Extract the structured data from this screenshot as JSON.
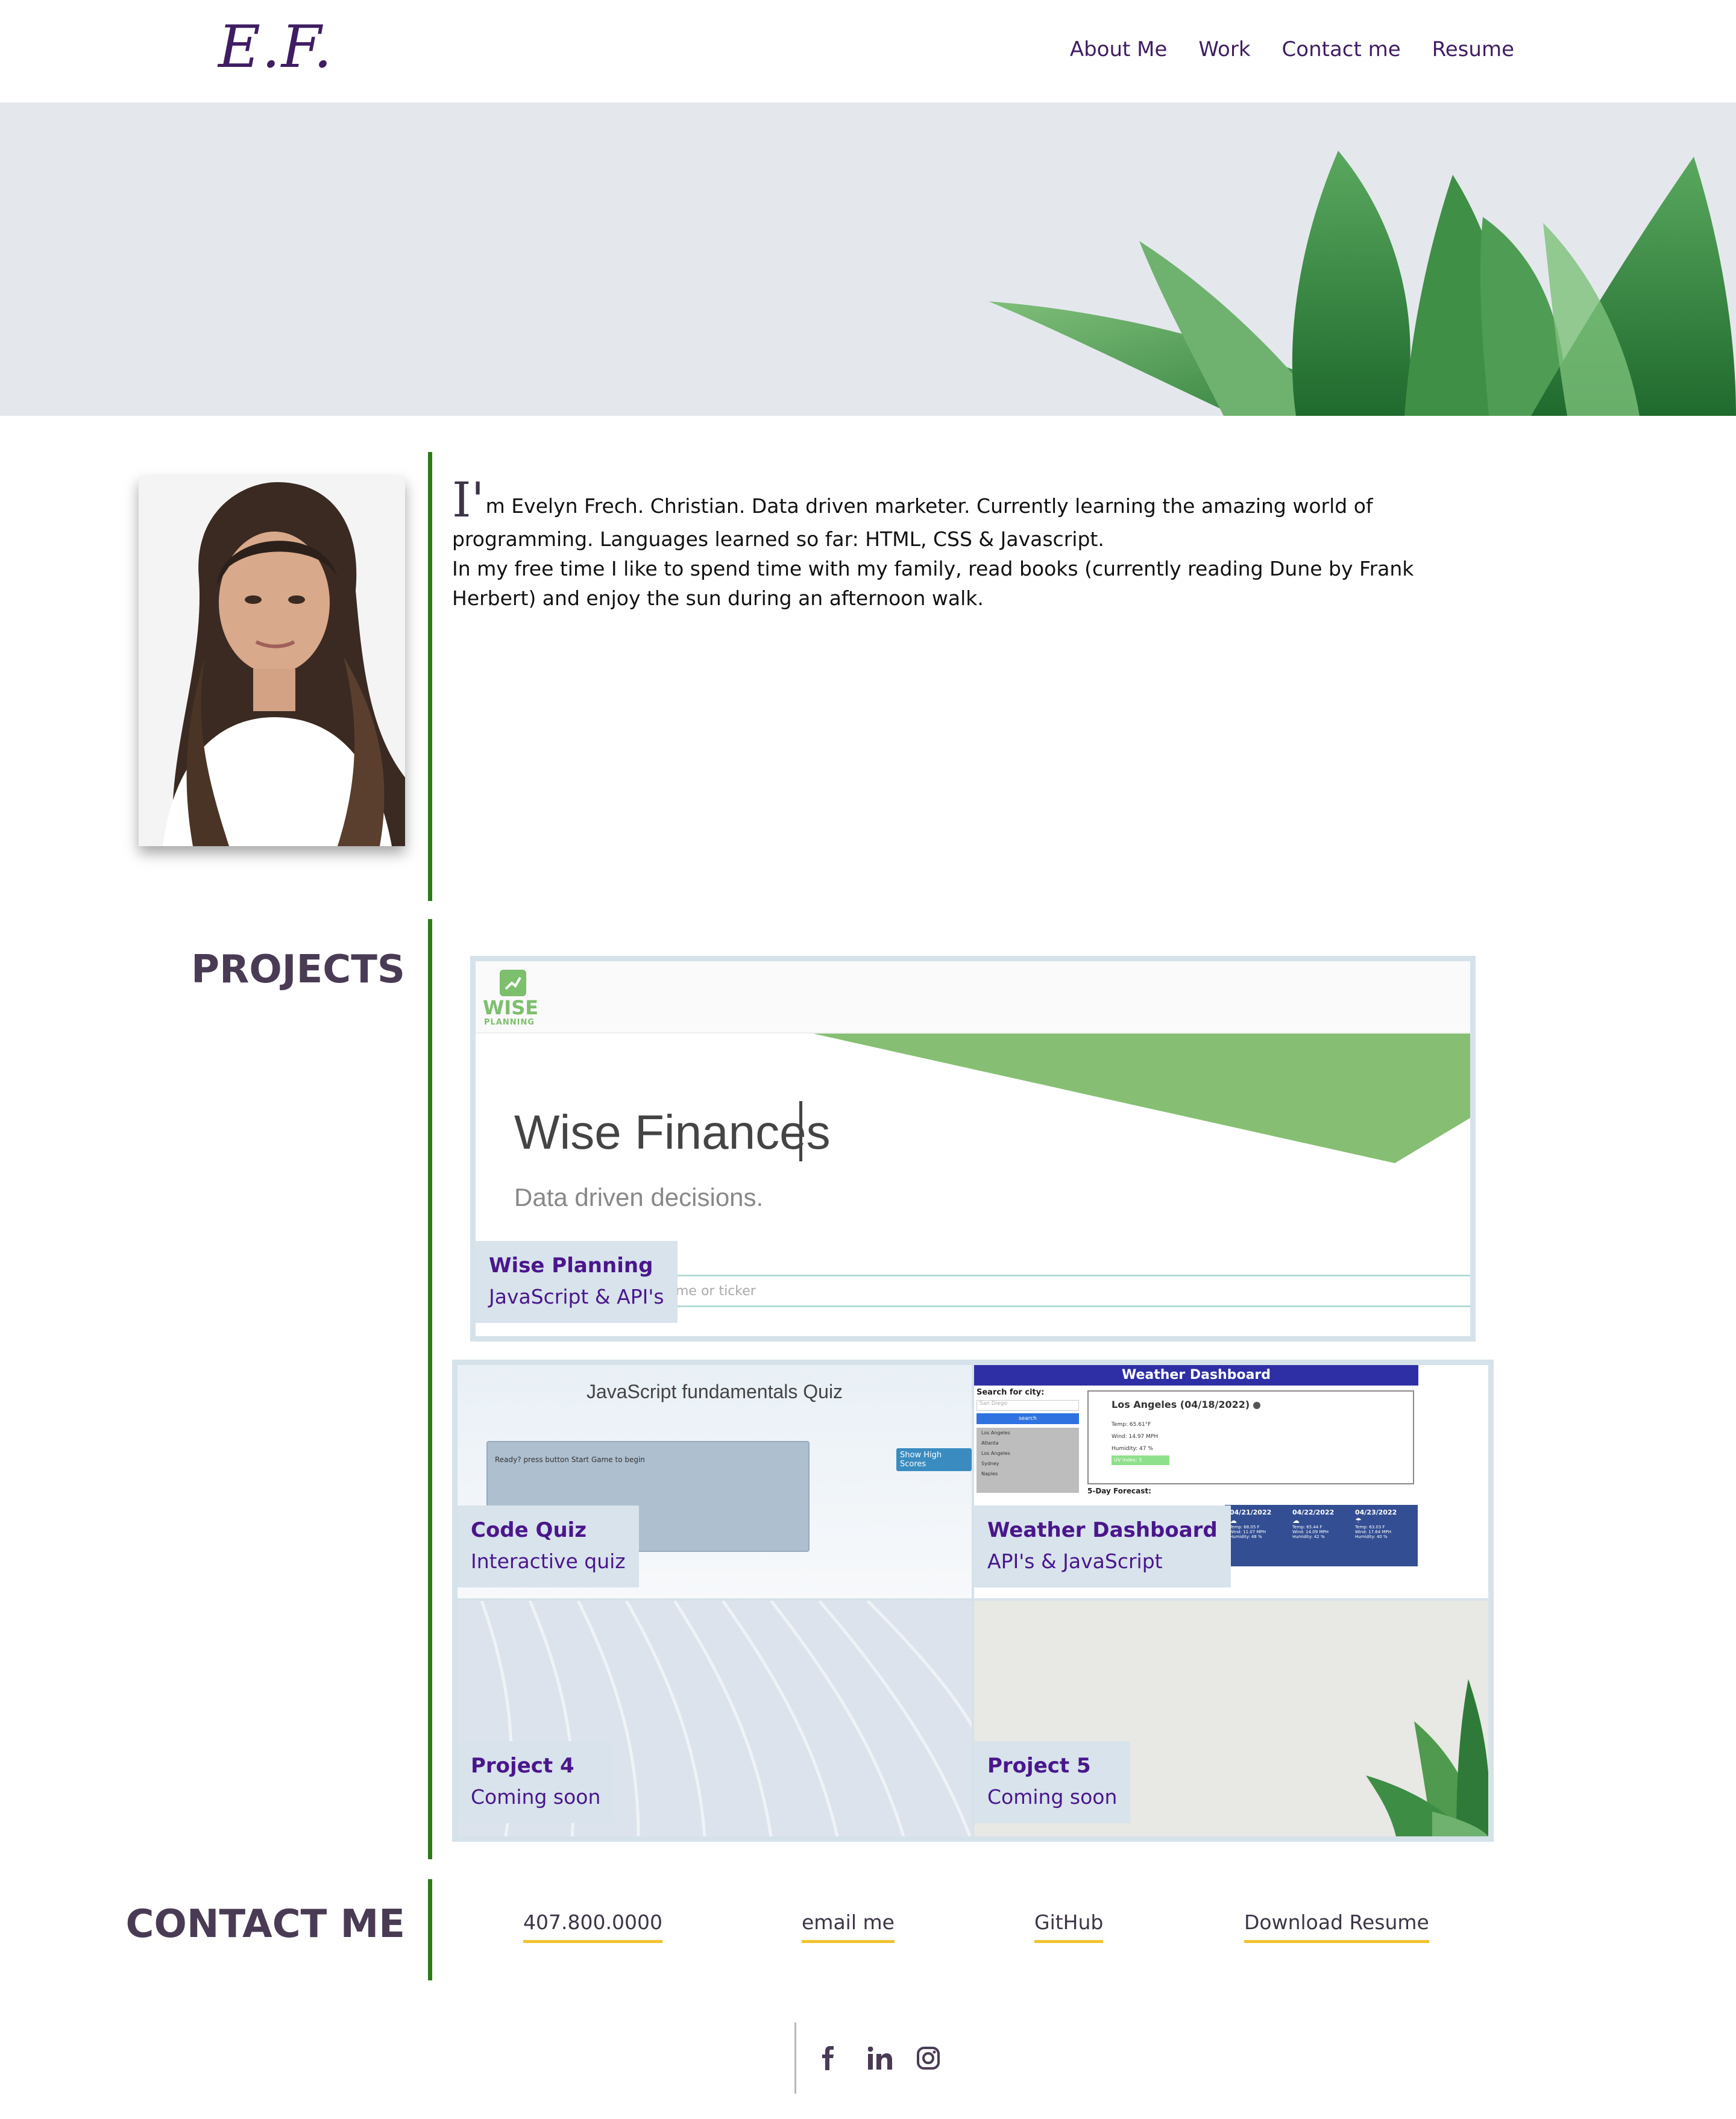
{
  "header": {
    "logo": "E.F.",
    "nav": [
      {
        "label": "About Me"
      },
      {
        "label": "Work"
      },
      {
        "label": "Contact me"
      },
      {
        "label": "Resume"
      }
    ]
  },
  "about": {
    "drop_letter": "I'",
    "line1": "m Evelyn Frech. Christian. Data driven marketer. Currently learning the amazing world of programming. Languages learned so far: HTML, CSS & Javascript.",
    "line2": "In my free time I like to spend time with my family, read books (currently reading Dune by Frank Herbert) and enjoy the sun during an afternoon walk."
  },
  "projects": {
    "title": "PROJECTS",
    "items": [
      {
        "title": "Wise Planning",
        "subtitle": "JavaScript & API's",
        "preview": {
          "brand": "WISE",
          "brand_sub": "PLANNING",
          "heading": "Wise Finances",
          "tagline": "Data driven decisions.",
          "search_placeholder": "me or ticker"
        }
      },
      {
        "title": "Code Quiz",
        "subtitle": "Interactive quiz",
        "preview": {
          "heading": "JavaScript fundamentals Quiz",
          "prompt": "Ready? press button Start Game to begin",
          "button": "Show High Scores"
        }
      },
      {
        "title": "Weather Dashboard",
        "subtitle": "API's & JavaScript",
        "preview": {
          "heading": "Weather Dashboard",
          "search_label": "Search for city:",
          "city_placeholder": "San Diego",
          "search_button": "search",
          "cities": [
            "Los Angeles",
            "Atlanta",
            "Los Angeles",
            "Sydney",
            "Naples"
          ],
          "current": "Los Angeles (04/18/2022)",
          "current_stats": [
            "Temp: 65.61°F",
            "Wind: 14.97 MPH",
            "Humidity: 47 %"
          ],
          "uv": "UV Index: 3",
          "forecast_label": "5-Day Forecast:",
          "forecast": [
            {
              "date": "04/21/2022",
              "stats": [
                "Temp: 68.05 F",
                "Wind: 11.07 MPH",
                "Humidity: 48 %"
              ]
            },
            {
              "date": "04/22/2022",
              "stats": [
                "Temp: 65.44 F",
                "Wind: 14.09 MPH",
                "Humidity: 42 %"
              ]
            },
            {
              "date": "04/23/2022",
              "stats": [
                "Temp: 63.03 F",
                "Wind: 17.64 MPH",
                "Humidity: 40 %"
              ]
            }
          ]
        }
      },
      {
        "title": "Project 4",
        "subtitle": "Coming soon"
      },
      {
        "title": "Project 5",
        "subtitle": "Coming soon"
      }
    ]
  },
  "contact": {
    "title": "CONTACT ME",
    "links": [
      {
        "label": "407.800.0000"
      },
      {
        "label": "email me"
      },
      {
        "label": "GitHub"
      },
      {
        "label": "Download Resume"
      }
    ]
  },
  "colors": {
    "brand_purple": "#3f1d63",
    "accent_green": "#2a7d16",
    "underline_yellow": "#f1c232",
    "card_border": "#d6e2ea"
  },
  "icons": [
    "facebook-icon",
    "linkedin-icon",
    "instagram-icon"
  ]
}
